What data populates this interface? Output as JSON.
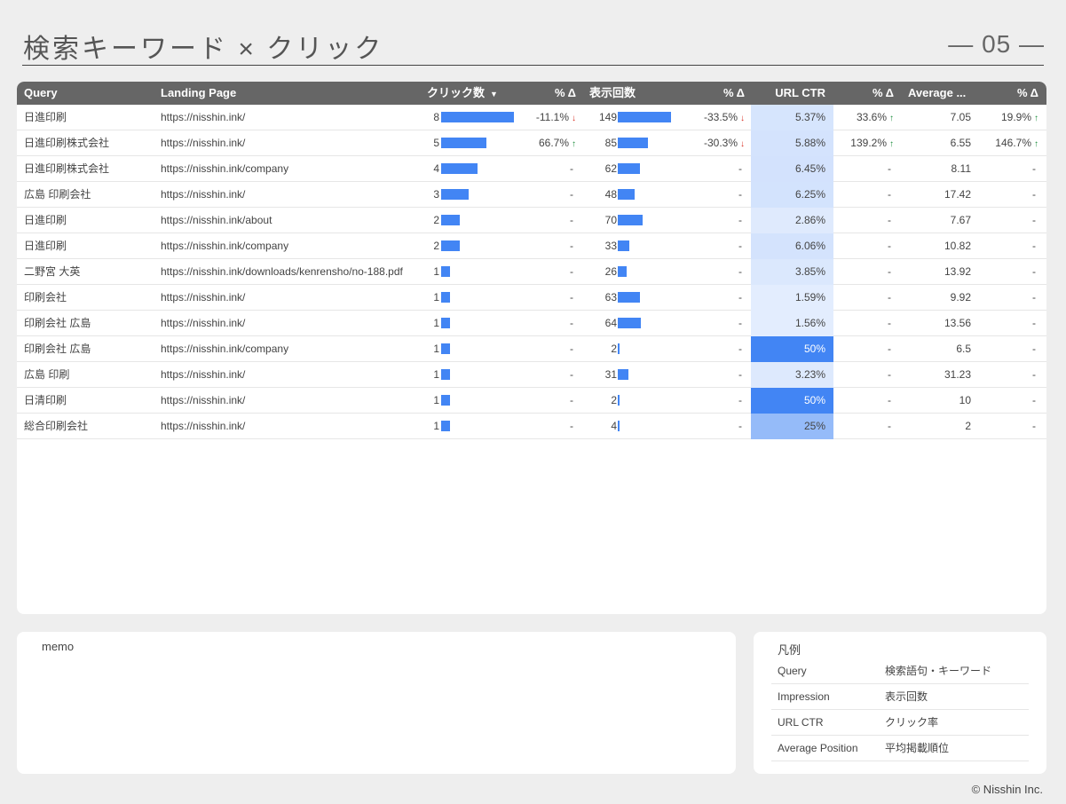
{
  "header": {
    "title": "検索キーワード × クリック",
    "page_number": "— 05 —"
  },
  "table": {
    "columns": {
      "query": "Query",
      "landing_page": "Landing Page",
      "clicks": "クリック数",
      "clicks_delta": "% Δ",
      "impressions": "表示回数",
      "impressions_delta": "% Δ",
      "ctr": "URL CTR",
      "ctr_delta": "% Δ",
      "position": "Average ...",
      "position_delta": "% Δ"
    },
    "sort_icon": "caret-down-icon",
    "rows": [
      {
        "query": "日進印刷",
        "page": "https://nisshin.ink/",
        "clicks": "8",
        "clicks_val": 8,
        "clicks_delta": "-11.1%",
        "clicks_dir": "down",
        "impr": "149",
        "impr_val": 149,
        "impr_delta": "-33.5%",
        "impr_dir": "down",
        "ctr": "5.37%",
        "ctr_val": 5.37,
        "ctr_delta": "33.6%",
        "ctr_dir": "up",
        "pos": "7.05",
        "pos_delta": "19.9%",
        "pos_dir": "up"
      },
      {
        "query": "日進印刷株式会社",
        "page": "https://nisshin.ink/",
        "clicks": "5",
        "clicks_val": 5,
        "clicks_delta": "66.7%",
        "clicks_dir": "up",
        "impr": "85",
        "impr_val": 85,
        "impr_delta": "-30.3%",
        "impr_dir": "down",
        "ctr": "5.88%",
        "ctr_val": 5.88,
        "ctr_delta": "139.2%",
        "ctr_dir": "up",
        "pos": "6.55",
        "pos_delta": "146.7%",
        "pos_dir": "up"
      },
      {
        "query": "日進印刷株式会社",
        "page": "https://nisshin.ink/company",
        "clicks": "4",
        "clicks_val": 4,
        "clicks_delta": "-",
        "clicks_dir": "",
        "impr": "62",
        "impr_val": 62,
        "impr_delta": "-",
        "impr_dir": "",
        "ctr": "6.45%",
        "ctr_val": 6.45,
        "ctr_delta": "-",
        "ctr_dir": "",
        "pos": "8.11",
        "pos_delta": "-",
        "pos_dir": ""
      },
      {
        "query": "広島 印刷会社",
        "page": "https://nisshin.ink/",
        "clicks": "3",
        "clicks_val": 3,
        "clicks_delta": "-",
        "clicks_dir": "",
        "impr": "48",
        "impr_val": 48,
        "impr_delta": "-",
        "impr_dir": "",
        "ctr": "6.25%",
        "ctr_val": 6.25,
        "ctr_delta": "-",
        "ctr_dir": "",
        "pos": "17.42",
        "pos_delta": "-",
        "pos_dir": ""
      },
      {
        "query": "日進印刷",
        "page": "https://nisshin.ink/about",
        "clicks": "2",
        "clicks_val": 2,
        "clicks_delta": "-",
        "clicks_dir": "",
        "impr": "70",
        "impr_val": 70,
        "impr_delta": "-",
        "impr_dir": "",
        "ctr": "2.86%",
        "ctr_val": 2.86,
        "ctr_delta": "-",
        "ctr_dir": "",
        "pos": "7.67",
        "pos_delta": "-",
        "pos_dir": ""
      },
      {
        "query": "日進印刷",
        "page": "https://nisshin.ink/company",
        "clicks": "2",
        "clicks_val": 2,
        "clicks_delta": "-",
        "clicks_dir": "",
        "impr": "33",
        "impr_val": 33,
        "impr_delta": "-",
        "impr_dir": "",
        "ctr": "6.06%",
        "ctr_val": 6.06,
        "ctr_delta": "-",
        "ctr_dir": "",
        "pos": "10.82",
        "pos_delta": "-",
        "pos_dir": ""
      },
      {
        "query": "二野宮 大英",
        "page": "https://nisshin.ink/downloads/kenrensho/no-188.pdf",
        "clicks": "1",
        "clicks_val": 1,
        "clicks_delta": "-",
        "clicks_dir": "",
        "impr": "26",
        "impr_val": 26,
        "impr_delta": "-",
        "impr_dir": "",
        "ctr": "3.85%",
        "ctr_val": 3.85,
        "ctr_delta": "-",
        "ctr_dir": "",
        "pos": "13.92",
        "pos_delta": "-",
        "pos_dir": ""
      },
      {
        "query": "印刷会社",
        "page": "https://nisshin.ink/",
        "clicks": "1",
        "clicks_val": 1,
        "clicks_delta": "-",
        "clicks_dir": "",
        "impr": "63",
        "impr_val": 63,
        "impr_delta": "-",
        "impr_dir": "",
        "ctr": "1.59%",
        "ctr_val": 1.59,
        "ctr_delta": "-",
        "ctr_dir": "",
        "pos": "9.92",
        "pos_delta": "-",
        "pos_dir": ""
      },
      {
        "query": "印刷会社 広島",
        "page": "https://nisshin.ink/",
        "clicks": "1",
        "clicks_val": 1,
        "clicks_delta": "-",
        "clicks_dir": "",
        "impr": "64",
        "impr_val": 64,
        "impr_delta": "-",
        "impr_dir": "",
        "ctr": "1.56%",
        "ctr_val": 1.56,
        "ctr_delta": "-",
        "ctr_dir": "",
        "pos": "13.56",
        "pos_delta": "-",
        "pos_dir": ""
      },
      {
        "query": "印刷会社 広島",
        "page": "https://nisshin.ink/company",
        "clicks": "1",
        "clicks_val": 1,
        "clicks_delta": "-",
        "clicks_dir": "",
        "impr": "2",
        "impr_val": 2,
        "impr_delta": "-",
        "impr_dir": "",
        "ctr": "50%",
        "ctr_val": 50,
        "ctr_delta": "-",
        "ctr_dir": "",
        "pos": "6.5",
        "pos_delta": "-",
        "pos_dir": ""
      },
      {
        "query": "広島 印刷",
        "page": "https://nisshin.ink/",
        "clicks": "1",
        "clicks_val": 1,
        "clicks_delta": "-",
        "clicks_dir": "",
        "impr": "31",
        "impr_val": 31,
        "impr_delta": "-",
        "impr_dir": "",
        "ctr": "3.23%",
        "ctr_val": 3.23,
        "ctr_delta": "-",
        "ctr_dir": "",
        "pos": "31.23",
        "pos_delta": "-",
        "pos_dir": ""
      },
      {
        "query": "日清印刷",
        "page": "https://nisshin.ink/",
        "clicks": "1",
        "clicks_val": 1,
        "clicks_delta": "-",
        "clicks_dir": "",
        "impr": "2",
        "impr_val": 2,
        "impr_delta": "-",
        "impr_dir": "",
        "ctr": "50%",
        "ctr_val": 50,
        "ctr_delta": "-",
        "ctr_dir": "",
        "pos": "10",
        "pos_delta": "-",
        "pos_dir": ""
      },
      {
        "query": "総合印刷会社",
        "page": "https://nisshin.ink/",
        "clicks": "1",
        "clicks_val": 1,
        "clicks_delta": "-",
        "clicks_dir": "",
        "impr": "4",
        "impr_val": 4,
        "impr_delta": "-",
        "impr_dir": "",
        "ctr": "25%",
        "ctr_val": 25,
        "ctr_delta": "-",
        "ctr_dir": "",
        "pos": "2",
        "pos_delta": "-",
        "pos_dir": ""
      }
    ]
  },
  "memo": {
    "label": "memo"
  },
  "legend": {
    "title": "凡例",
    "items": [
      {
        "key": "Query",
        "value": "検索語句・キーワード"
      },
      {
        "key": "Impression",
        "value": "表示回数"
      },
      {
        "key": "URL CTR",
        "value": "クリック率"
      },
      {
        "key": "Average Position",
        "value": "平均掲載順位"
      }
    ]
  },
  "footer": {
    "copyright": "© Nisshin Inc."
  },
  "colors": {
    "bar": "#4285f4",
    "up": "#1e8e3e",
    "down": "#d93025",
    "header_bg": "#666666"
  }
}
